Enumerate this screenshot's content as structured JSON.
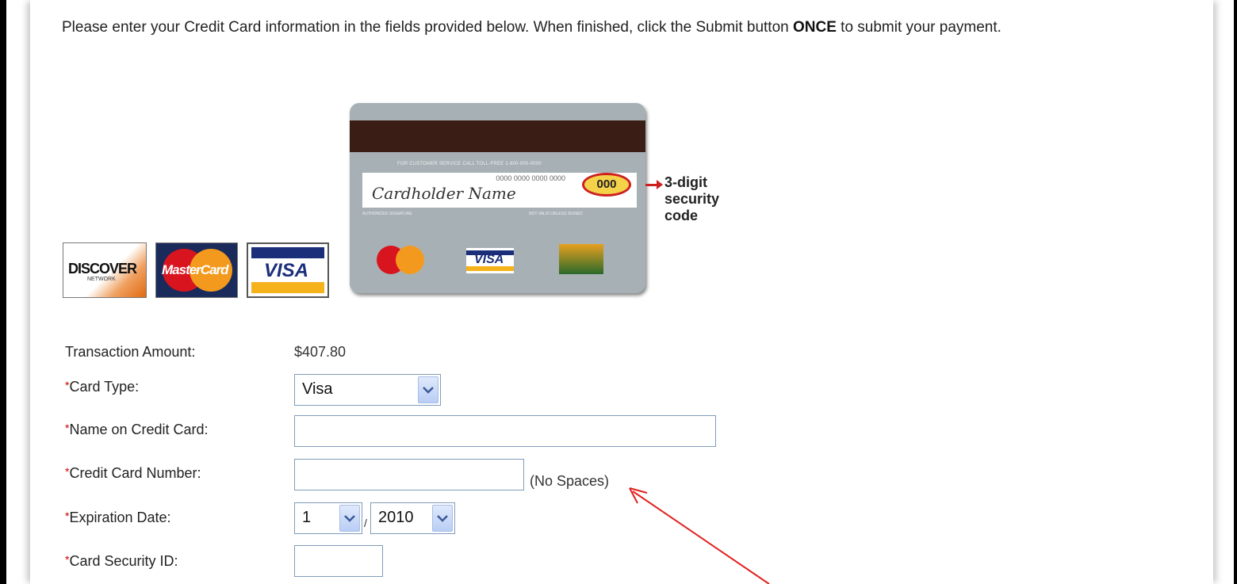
{
  "intro": {
    "text_before": "Please enter your Credit Card information in the fields provided below. When finished, click the Submit button ",
    "emphasis": "ONCE",
    "text_after": " to submit your payment."
  },
  "logos": {
    "discover": "DISCOVER",
    "discover_sub": "NETWORK",
    "mastercard": "MasterCard",
    "visa": "VISA"
  },
  "card_back": {
    "service_text": "FOR CUSTOMER SERVICE CALL TOLL-FREE 1-800-000-0000",
    "card_number": "0000 0000 0000 0000",
    "cardholder_name": "Cardholder Name",
    "security_code": "000",
    "authorized_signature": "AUTHORIZED SIGNATURE",
    "not_valid": "NOT VALID UNLESS SIGNED",
    "mini_visa": "VISA",
    "callout_line1": "3-digit",
    "callout_line2": "security",
    "callout_line3": "code"
  },
  "form": {
    "required_marker": "*",
    "transaction_amount_label": "Transaction Amount:",
    "transaction_amount_value": "$407.80",
    "card_type_label": "Card Type:",
    "card_type_value": "Visa",
    "name_label": "Name on Credit Card:",
    "name_value": "",
    "number_label": "Credit Card Number:",
    "number_value": "",
    "number_note": "(No Spaces)",
    "expiration_label": "Expiration Date:",
    "exp_month": "1",
    "exp_separator": "/",
    "exp_year": "2010",
    "security_label": "Card Security ID:",
    "security_value": ""
  },
  "colors": {
    "annotation_arrow": "#e0201e",
    "required_marker": "#cc0000"
  }
}
